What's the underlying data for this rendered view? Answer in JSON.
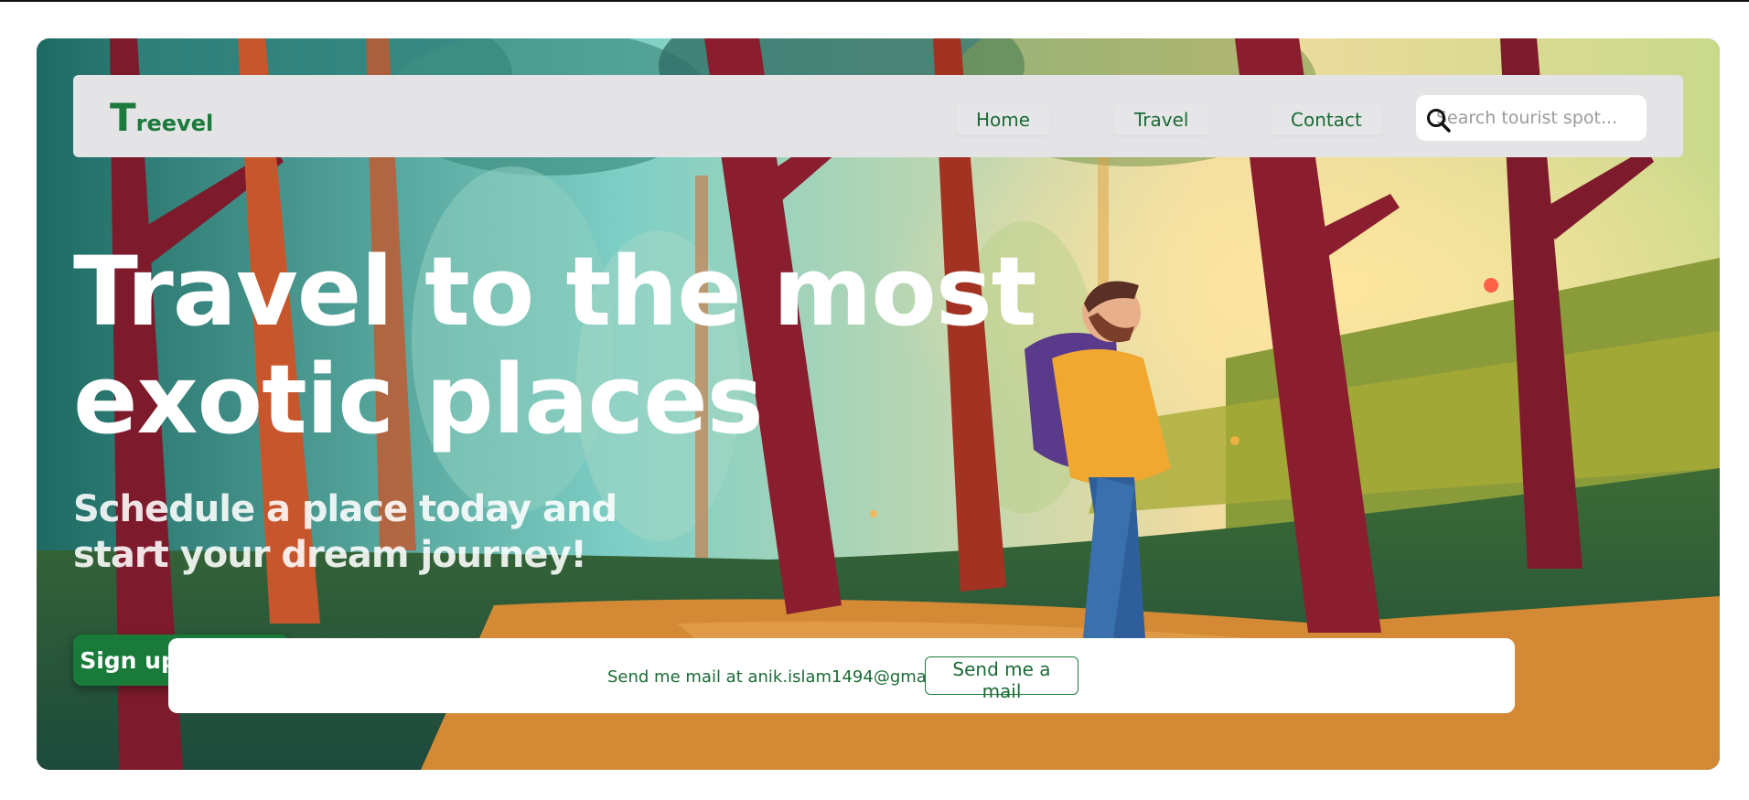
{
  "colors": {
    "brand": "#1b7a3c",
    "navbar_bg": "#e4e4e6",
    "cta_bg": "#1a7a3a",
    "headline": "#ffffff"
  },
  "navbar": {
    "brand_initial": "T",
    "brand_rest": "reevel",
    "links": [
      "Home",
      "Travel",
      "Contact"
    ],
    "search": {
      "placeholder": "Search tourist spot...",
      "icon": "magnifier-icon"
    }
  },
  "hero": {
    "headline": "Travel to the most exotic places",
    "subheadline": "Schedule a place today and start your dream journey!",
    "cta_label": "Sign up for free"
  },
  "contact_bar": {
    "text": "Send me mail at anik.islam1494@gmail.com",
    "button_label": "Send me a mail"
  }
}
